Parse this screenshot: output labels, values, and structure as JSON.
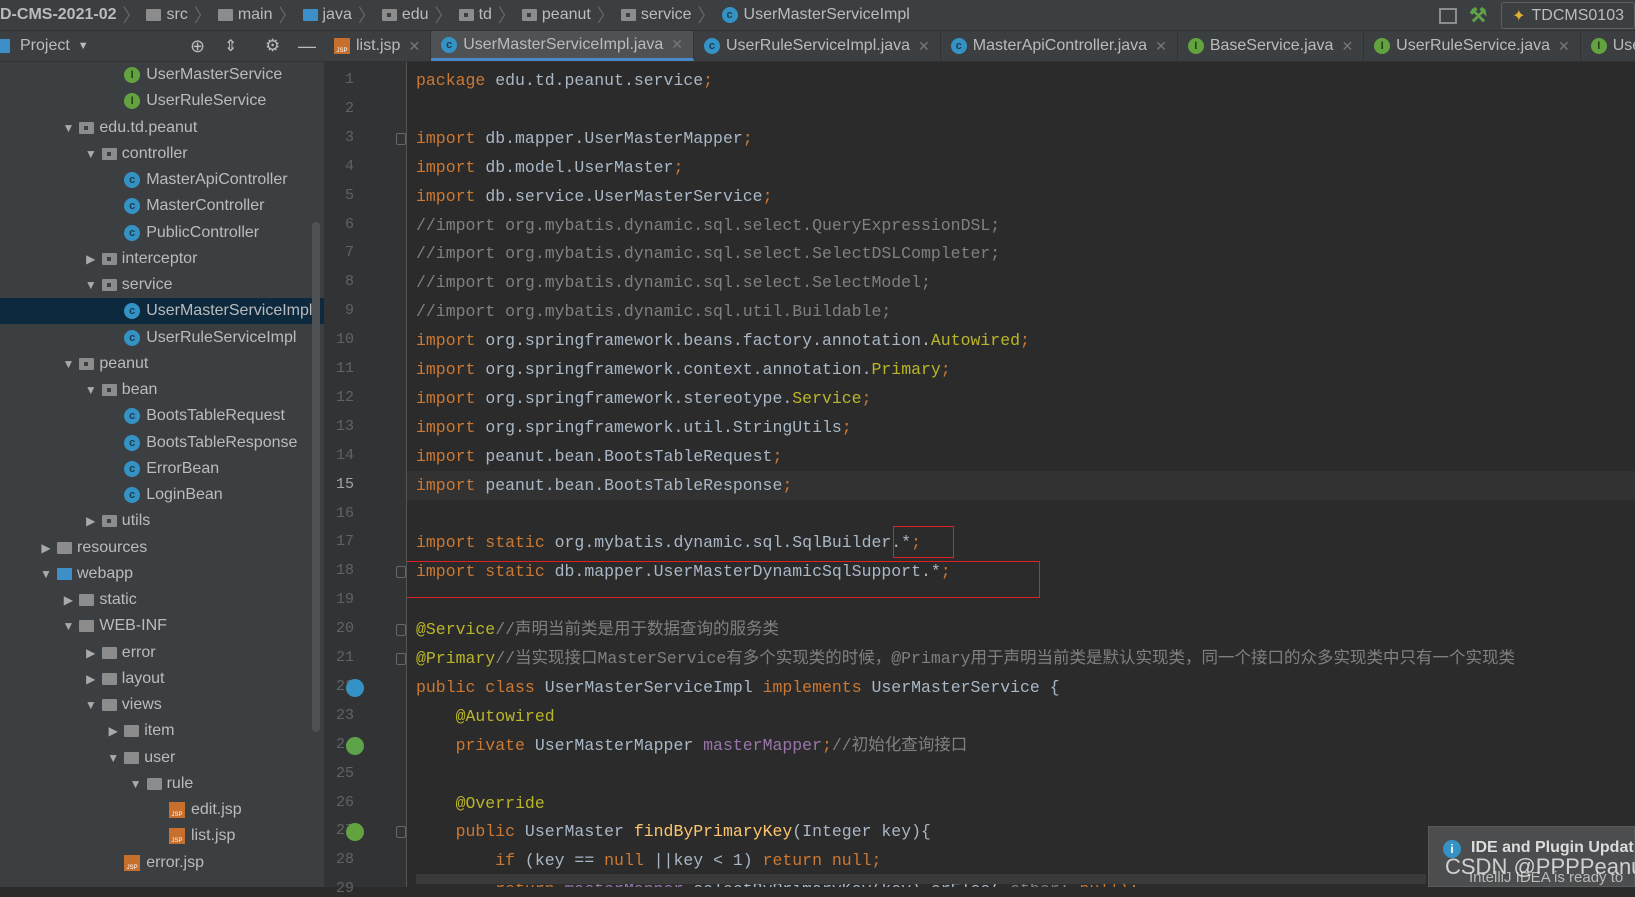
{
  "breadcrumb": [
    {
      "label": "D-CMS-2021-02",
      "icon": "none"
    },
    {
      "label": "src",
      "icon": "folder"
    },
    {
      "label": "main",
      "icon": "folder"
    },
    {
      "label": "java",
      "icon": "folder-blue"
    },
    {
      "label": "edu",
      "icon": "package"
    },
    {
      "label": "td",
      "icon": "package"
    },
    {
      "label": "peanut",
      "icon": "package"
    },
    {
      "label": "service",
      "icon": "package"
    },
    {
      "label": "UserMasterServiceImpl",
      "icon": "class"
    }
  ],
  "toolbar": {
    "run_config": "TDCMS0103"
  },
  "project_panel": {
    "title": "Project"
  },
  "tabs": [
    {
      "label": "list.jsp",
      "icon": "jsp",
      "active": false
    },
    {
      "label": "UserMasterServiceImpl.java",
      "icon": "class",
      "active": true
    },
    {
      "label": "UserRuleServiceImpl.java",
      "icon": "class",
      "active": false
    },
    {
      "label": "MasterApiController.java",
      "icon": "class",
      "active": false
    },
    {
      "label": "BaseService.java",
      "icon": "interface",
      "active": false
    },
    {
      "label": "UserRuleService.java",
      "icon": "interface",
      "active": false
    },
    {
      "label": "Use",
      "icon": "interface",
      "active": false
    }
  ],
  "tree": [
    {
      "label": "UserMasterService",
      "level": 3,
      "type": "interface"
    },
    {
      "label": "UserRuleService",
      "level": 3,
      "type": "interface"
    },
    {
      "label": "edu.td.peanut",
      "level": 1,
      "type": "package",
      "state": "open"
    },
    {
      "label": "controller",
      "level": 2,
      "type": "package",
      "state": "open"
    },
    {
      "label": "MasterApiController",
      "level": 3,
      "type": "class"
    },
    {
      "label": "MasterController",
      "level": 3,
      "type": "class"
    },
    {
      "label": "PublicController",
      "level": 3,
      "type": "class"
    },
    {
      "label": "interceptor",
      "level": 2,
      "type": "package",
      "state": "closed"
    },
    {
      "label": "service",
      "level": 2,
      "type": "package",
      "state": "open"
    },
    {
      "label": "UserMasterServiceImpl",
      "level": 3,
      "type": "class",
      "selected": true
    },
    {
      "label": "UserRuleServiceImpl",
      "level": 3,
      "type": "class"
    },
    {
      "label": "peanut",
      "level": 1,
      "type": "package",
      "state": "open"
    },
    {
      "label": "bean",
      "level": 2,
      "type": "package",
      "state": "open"
    },
    {
      "label": "BootsTableRequest",
      "level": 3,
      "type": "class"
    },
    {
      "label": "BootsTableResponse",
      "level": 3,
      "type": "class"
    },
    {
      "label": "ErrorBean",
      "level": 3,
      "type": "class"
    },
    {
      "label": "LoginBean",
      "level": 3,
      "type": "class"
    },
    {
      "label": "utils",
      "level": 2,
      "type": "package",
      "state": "closed"
    },
    {
      "label": "resources",
      "level": 0,
      "type": "folder",
      "state": "closed"
    },
    {
      "label": "webapp",
      "level": 0,
      "type": "folder-blue",
      "state": "open"
    },
    {
      "label": "static",
      "level": 1,
      "type": "folder",
      "state": "closed"
    },
    {
      "label": "WEB-INF",
      "level": 1,
      "type": "folder",
      "state": "open"
    },
    {
      "label": "error",
      "level": 2,
      "type": "folder",
      "state": "closed"
    },
    {
      "label": "layout",
      "level": 2,
      "type": "folder",
      "state": "closed"
    },
    {
      "label": "views",
      "level": 2,
      "type": "folder",
      "state": "open"
    },
    {
      "label": "item",
      "level": 3,
      "type": "folder",
      "state": "closed"
    },
    {
      "label": "user",
      "level": 3,
      "type": "folder",
      "state": "open"
    },
    {
      "label": "rule",
      "level": 4,
      "type": "folder",
      "state": "open"
    },
    {
      "label": "edit.jsp",
      "level": 5,
      "type": "jsp"
    },
    {
      "label": "list.jsp",
      "level": 5,
      "type": "jsp"
    },
    {
      "label": "error.jsp",
      "level": 3,
      "type": "jsp"
    }
  ],
  "editor": {
    "current_line": 15,
    "lines": [
      [
        [
          "package ",
          "k"
        ],
        [
          "edu.td.peanut.service",
          "p"
        ],
        [
          ";",
          "k"
        ]
      ],
      [],
      [
        [
          "import ",
          "k"
        ],
        [
          "db.mapper.UserMasterMapper",
          "p"
        ],
        [
          ";",
          "k"
        ]
      ],
      [
        [
          "import ",
          "k"
        ],
        [
          "db.model.UserMaster",
          "p"
        ],
        [
          ";",
          "k"
        ]
      ],
      [
        [
          "import ",
          "k"
        ],
        [
          "db.service.UserMasterService",
          "p"
        ],
        [
          ";",
          "k"
        ]
      ],
      [
        [
          "//import org.mybatis.dynamic.sql.select.QueryExpressionDSL;",
          "c"
        ]
      ],
      [
        [
          "//import org.mybatis.dynamic.sql.select.SelectDSLCompleter;",
          "c"
        ]
      ],
      [
        [
          "//import org.mybatis.dynamic.sql.select.SelectModel;",
          "c"
        ]
      ],
      [
        [
          "//import org.mybatis.dynamic.sql.util.Buildable;",
          "c"
        ]
      ],
      [
        [
          "import ",
          "k"
        ],
        [
          "org.springframework.beans.factory.annotation.",
          "p"
        ],
        [
          "Autowired",
          "a"
        ],
        [
          ";",
          "k"
        ]
      ],
      [
        [
          "import ",
          "k"
        ],
        [
          "org.springframework.context.annotation.",
          "p"
        ],
        [
          "Primary",
          "a"
        ],
        [
          ";",
          "k"
        ]
      ],
      [
        [
          "import ",
          "k"
        ],
        [
          "org.springframework.stereotype.",
          "p"
        ],
        [
          "Service",
          "a"
        ],
        [
          ";",
          "k"
        ]
      ],
      [
        [
          "import ",
          "k"
        ],
        [
          "org.springframework.util.StringUtils",
          "p"
        ],
        [
          ";",
          "k"
        ]
      ],
      [
        [
          "import ",
          "k"
        ],
        [
          "peanut.bean.BootsTableRequest",
          "p"
        ],
        [
          ";",
          "k"
        ]
      ],
      [
        [
          "import ",
          "k"
        ],
        [
          "peanut.bean.BootsTableResponse",
          "p"
        ],
        [
          ";",
          "k"
        ]
      ],
      [],
      [
        [
          "import static ",
          "k"
        ],
        [
          "org.mybatis.dynamic.sql.SqlBuilder.*",
          "p"
        ],
        [
          ";",
          "k"
        ]
      ],
      [
        [
          "import static ",
          "k"
        ],
        [
          "db.mapper.UserMasterDynamicSqlSupport.*",
          "p"
        ],
        [
          ";",
          "k"
        ]
      ],
      [],
      [
        [
          "@Service",
          "a"
        ],
        [
          "//声明当前类是用于数据查询的服务类",
          "c"
        ]
      ],
      [
        [
          "@Primary",
          "a"
        ],
        [
          "//当实现接口MasterService有多个实现类的时候，@Primary用于声明当前类是默认实现类，同一个接口的众多实现类中只有一个实现类",
          "c"
        ]
      ],
      [
        [
          "public class ",
          "k"
        ],
        [
          "UserMasterServiceImpl ",
          "p"
        ],
        [
          "implements ",
          "k"
        ],
        [
          "UserMasterService {",
          "p"
        ]
      ],
      [
        [
          "    @Autowired",
          "a"
        ]
      ],
      [
        [
          "    private ",
          "k"
        ],
        [
          "UserMasterMapper ",
          "p"
        ],
        [
          "masterMapper",
          "f"
        ],
        [
          ";",
          "k"
        ],
        [
          "//初始化查询接口",
          "c"
        ]
      ],
      [],
      [
        [
          "    @Override",
          "a"
        ]
      ],
      [
        [
          "    public ",
          "k"
        ],
        [
          "UserMaster ",
          "p"
        ],
        [
          "findByPrimaryKey",
          "m"
        ],
        [
          "(Integer key){",
          "p"
        ]
      ],
      [
        [
          "        if ",
          "k"
        ],
        [
          "(key == ",
          "p"
        ],
        [
          "null ",
          "k"
        ],
        [
          "||key < 1) ",
          "p"
        ],
        [
          "return null",
          "k"
        ],
        [
          ";",
          "k"
        ]
      ],
      [
        [
          "        return ",
          "k"
        ],
        [
          "masterMapper",
          "f"
        ],
        [
          ".selectByPrimaryKey(key).orElse( ",
          "p"
        ],
        [
          "other: ",
          "c"
        ],
        [
          "null",
          "k"
        ],
        [
          ");",
          "k"
        ]
      ]
    ]
  },
  "notification": {
    "title": "IDE and Plugin Update",
    "text": "IntelliJ IDEA is ready to"
  },
  "watermark": "CSDN @PPPPeanut",
  "colors": {
    "keyword": "#cc7832",
    "annotation": "#bbb529",
    "comment": "#808080",
    "plain": "#a9b7c6",
    "field": "#9876aa",
    "method": "#ffc66d",
    "highlight_box": "#e02020"
  }
}
